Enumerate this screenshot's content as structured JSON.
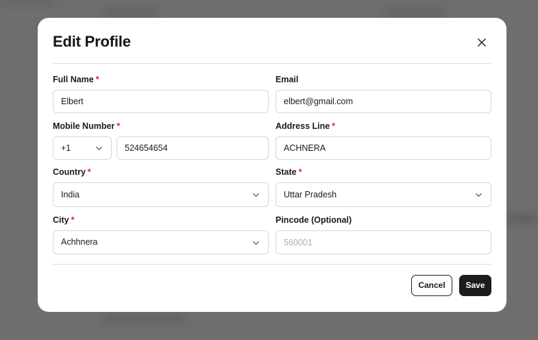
{
  "modal": {
    "title": "Edit Profile"
  },
  "form": {
    "full_name": {
      "label": "Full Name",
      "required": "*",
      "value": "Elbert"
    },
    "email": {
      "label": "Email",
      "value": "elbert@gmail.com"
    },
    "mobile": {
      "label": "Mobile Number",
      "required": "*",
      "country_code": "+1",
      "value": "524654654"
    },
    "address": {
      "label": "Address Line",
      "required": "*",
      "value": "ACHNERA"
    },
    "country": {
      "label": "Country",
      "required": "*",
      "value": "India"
    },
    "state": {
      "label": "State",
      "required": "*",
      "value": "Uttar Pradesh"
    },
    "city": {
      "label": "City",
      "required": "*",
      "value": "Achhnera"
    },
    "pincode": {
      "label": "Pincode (Optional)",
      "placeholder": "560001"
    }
  },
  "actions": {
    "cancel_label": "Cancel",
    "save_label": "Save"
  },
  "icons": {
    "close": "close-icon",
    "dropdown": "chevron-down-icon"
  },
  "colors": {
    "required": "#e02424",
    "primary_button": "#1c1c1c",
    "overlay": "#6e6e6e"
  }
}
